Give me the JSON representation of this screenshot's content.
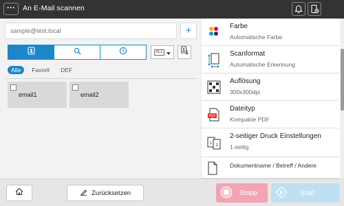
{
  "header": {
    "menu_label": "···",
    "title": "An E-Mail scannen",
    "icons": [
      "bell-icon",
      "device-status-icon"
    ]
  },
  "address": {
    "input_placeholder": "sample@test.local",
    "add_label": "+"
  },
  "search_tabs": [
    "address-book-icon",
    "search-icon",
    "history-icon"
  ],
  "type_filter": {
    "label": "ALL"
  },
  "filters": [
    "Alle",
    "Favorit",
    "DEF"
  ],
  "destinations": [
    {
      "label": "email1"
    },
    {
      "label": "email2"
    }
  ],
  "settings": [
    {
      "title": "Farbe",
      "value": "Automatische  Farbe"
    },
    {
      "title": "Scanformat",
      "value": "Automatische  Erkennung"
    },
    {
      "title": "Auflösung",
      "value": "300x300dpi"
    },
    {
      "title": "Dateityp",
      "value": "Kompakte  PDF",
      "badge": "PDF"
    },
    {
      "title": "2-seitiger  Druck  Einstellungen",
      "value": "1-seitig"
    },
    {
      "title": "Dokumentname  /  Betreff  /  Andere",
      "value": ""
    }
  ],
  "footer": {
    "reset_label": "Zurücksetzen",
    "stop_label": "Stopp",
    "start_label": "Start"
  },
  "colors": {
    "accent": "#1c86c9",
    "stop": "#f3a3b3",
    "start": "#bfe0f3",
    "topbar": "#333333"
  }
}
